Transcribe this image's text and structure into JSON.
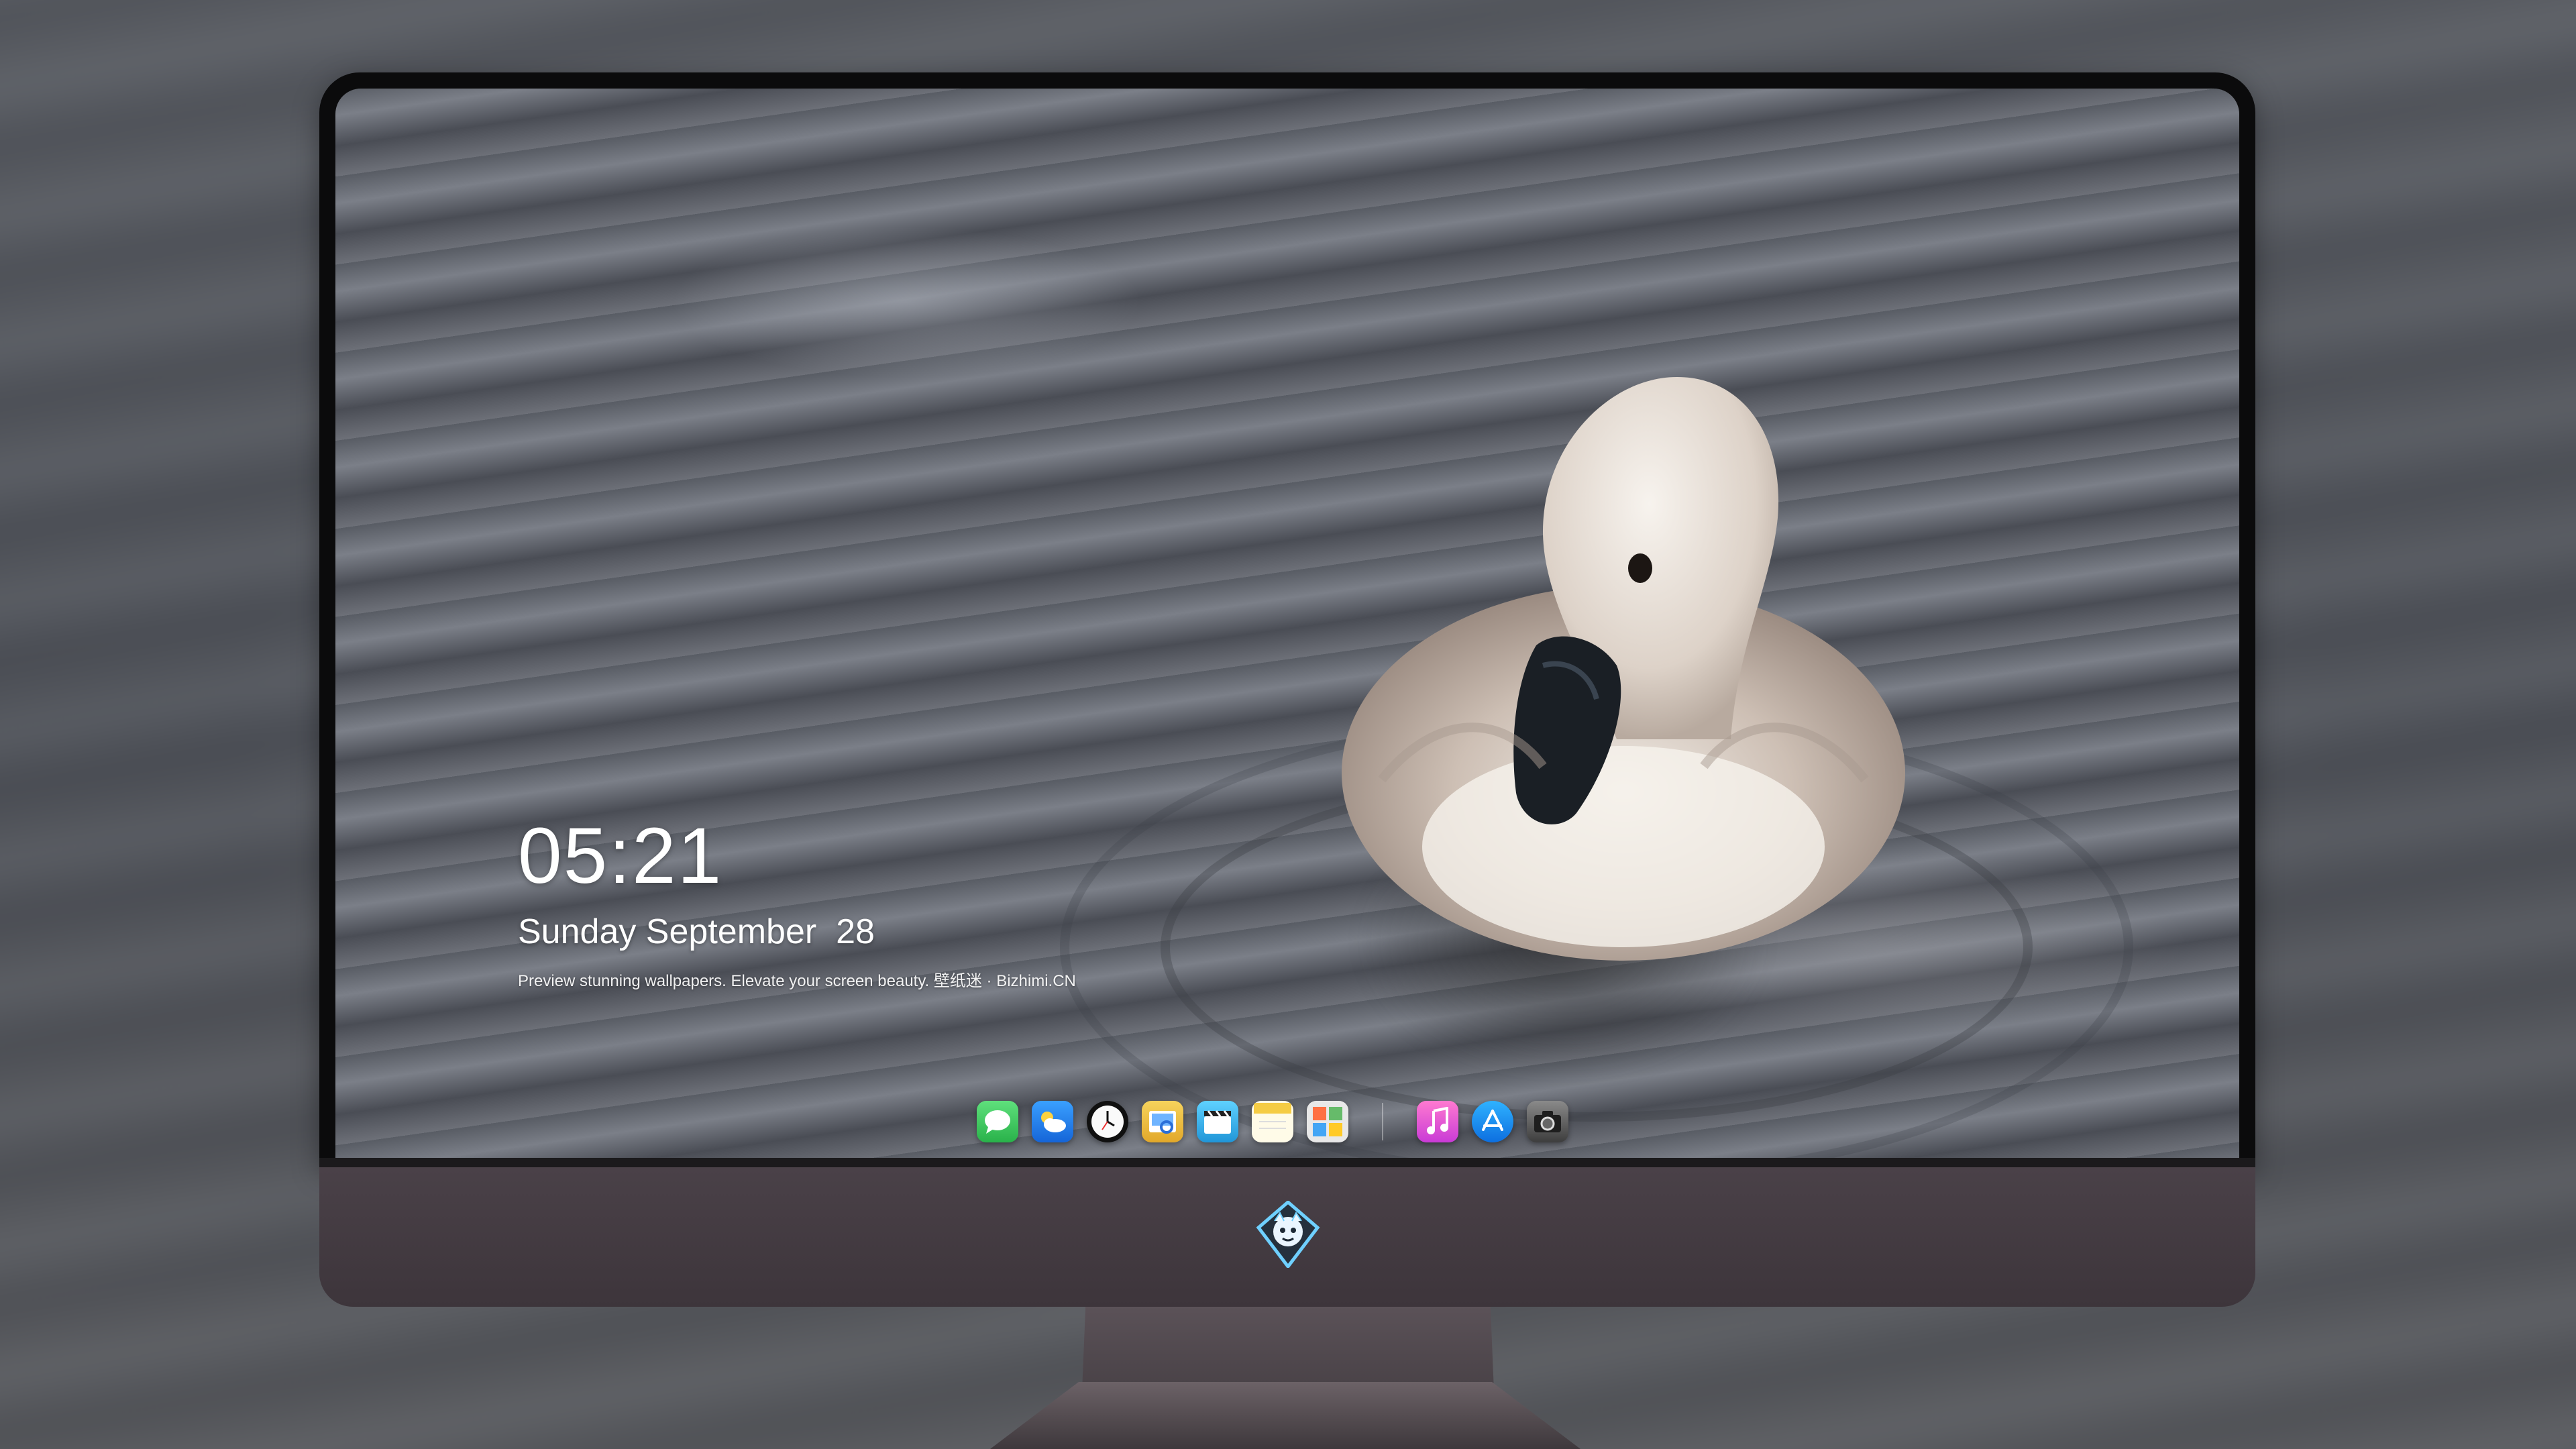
{
  "lockscreen": {
    "time": "05:21",
    "date": "Sunday September  28",
    "tagline": "Preview stunning wallpapers. Elevate your screen beauty. 壁纸迷 · Bizhimi.CN"
  },
  "dock": {
    "apps": [
      {
        "icon": "messages-icon",
        "color": "#34c759"
      },
      {
        "icon": "weather-icon",
        "color": "#1e90ff"
      },
      {
        "icon": "clock-icon",
        "color": "#111111"
      },
      {
        "icon": "preview-icon",
        "color": "#f3c343"
      },
      {
        "icon": "clips-icon",
        "color": "#3bb7e8"
      },
      {
        "icon": "notes-icon",
        "color": "#f5d35a"
      },
      {
        "icon": "photo-booth-icon",
        "color": "#d8d8d8"
      },
      {
        "icon": "music-icon",
        "color": "#f05ec2"
      },
      {
        "icon": "app-store-icon",
        "color": "#1a8cff"
      },
      {
        "icon": "camera-icon",
        "color": "#4a4a4a"
      }
    ]
  },
  "monitor": {
    "badge": "monitor-logo-badge",
    "bezel_color": "#3f373d"
  }
}
